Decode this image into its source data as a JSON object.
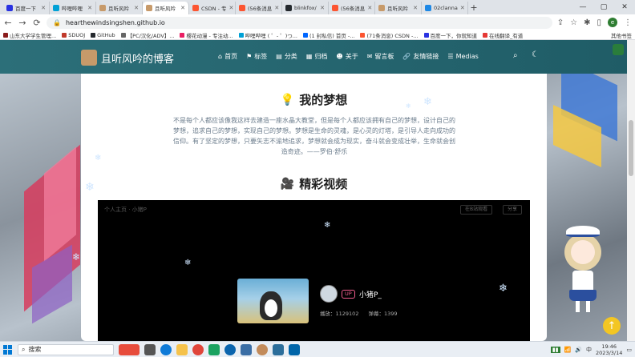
{
  "browser": {
    "tabs": [
      {
        "label": "百度一下",
        "active": false,
        "color": "#2932e1"
      },
      {
        "label": "哔哩哔哩",
        "active": false,
        "color": "#00a1d6"
      },
      {
        "label": "且听风吟",
        "active": false,
        "color": "#c79a6a"
      },
      {
        "label": "且听风吟",
        "active": true,
        "color": "#c79a6a"
      },
      {
        "label": "CSDN - 专",
        "active": false,
        "color": "#fc5531"
      },
      {
        "label": "(56条消息",
        "active": false,
        "color": "#fc5531"
      },
      {
        "label": "blinkfox/",
        "active": false,
        "color": "#24292e"
      },
      {
        "label": "(56条消息",
        "active": false,
        "color": "#fc5531"
      },
      {
        "label": "且听风吟",
        "active": false,
        "color": "#c79a6a"
      },
      {
        "label": "02clanna",
        "active": false,
        "color": "#1e88e5"
      }
    ],
    "url": "hearthewindsingshen.github.io",
    "bookmarks": [
      {
        "label": "山东大学学生管理...",
        "color": "#8a1c1c"
      },
      {
        "label": "SDUOJ",
        "color": "#c0392b"
      },
      {
        "label": "GitHub",
        "color": "#24292e"
      },
      {
        "label": "【PC/汉化/ADV】...",
        "color": "#666"
      },
      {
        "label": "樱花动漫 - 专注动...",
        "color": "#e91e63"
      },
      {
        "label": "哔哩哔哩 ( ゜- ゜)つ...",
        "color": "#00a1d6"
      },
      {
        "label": "(1 封私信) 首页 -...",
        "color": "#0066ff"
      },
      {
        "label": "(71条消息) CSDN -...",
        "color": "#fc5531"
      },
      {
        "label": "百度一下，你就知道",
        "color": "#2932e1"
      },
      {
        "label": "在线翻译_有道",
        "color": "#e53935"
      }
    ],
    "bookmarks_other": "其他书签",
    "profile_initial": "e"
  },
  "site": {
    "logo_text": "且听风吟的博客",
    "menu": [
      "首页",
      "标签",
      "分类",
      "归档",
      "关于",
      "留言板",
      "友情链接",
      "Medias"
    ]
  },
  "dream": {
    "title": "我的梦想",
    "text": "不是每个人都应该像我这样去建造一座水晶大教堂，但是每个人都应该拥有自己的梦想，设计自己的梦想，追求自己的梦想，实现自己的梦想。梦想是生命的灵魂，是心灵的灯塔，是引导人走向成功的信仰。有了坚定的梦想，只要矢志不渝地追求，梦想就会成为现实，奋斗就会变成壮举，生命就会创造奇迹。——罗伯·舒乐"
  },
  "video": {
    "title": "精彩视频",
    "header_text": "个人主页 · 小猪P",
    "btn_left": "在B站观看",
    "btn_right": "分享",
    "up_tag": "UP",
    "uploader": "小猪P_",
    "plays": "播放：1129102",
    "danmaku": "弹幕：1399"
  },
  "taskbar": {
    "search_placeholder": "搜索",
    "time": "19:46",
    "date": "2023/3/14"
  },
  "colors": {
    "nav_bg": "#2c6f79",
    "accent": "#f3c623"
  }
}
